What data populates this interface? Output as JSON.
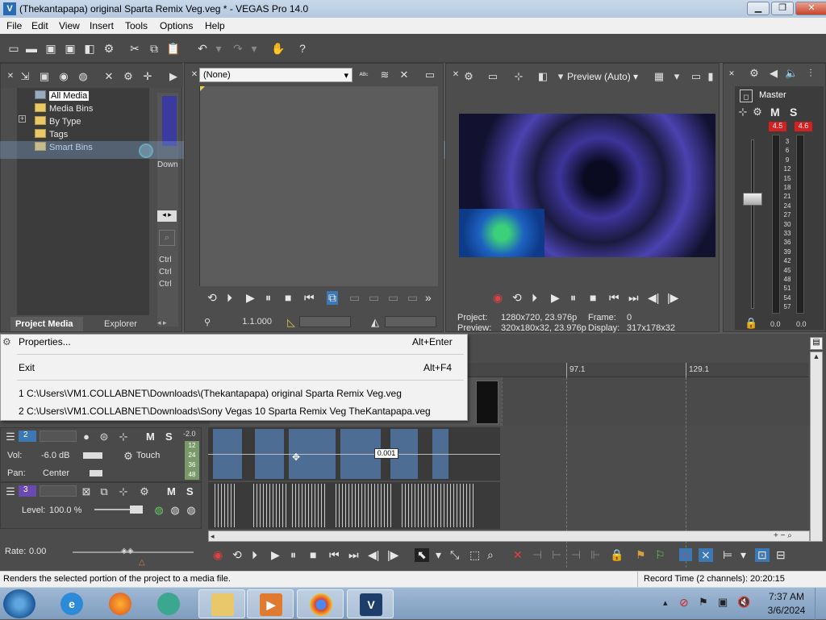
{
  "window": {
    "title": "(Thekantapapa) original Sparta Remix Veg.veg * - VEGAS Pro 14.0",
    "app_icon_letter": "V"
  },
  "menu": [
    "File",
    "Edit",
    "View",
    "Insert",
    "Tools",
    "Options",
    "Help"
  ],
  "project_media": {
    "tree": [
      "All Media",
      "Media Bins",
      "By Type",
      "Tags",
      "Smart Bins"
    ],
    "expander": "+",
    "tabs": [
      "Project Media",
      "Explorer"
    ],
    "side_label": "Down",
    "ctrl_labels": [
      "Ctrl",
      "Ctrl",
      "Ctrl"
    ]
  },
  "trimmer": {
    "dropdown_value": "(None)",
    "timecode": "1.1.000"
  },
  "preview": {
    "mode_label": "Preview (Auto)",
    "project_label": "Project:",
    "project_value": "1280x720, 23.976p",
    "preview_label": "Preview:",
    "preview_value": "320x180x32, 23.976p",
    "frame_label": "Frame:",
    "frame_value": "0",
    "display_label": "Display:",
    "display_value": "317x178x32"
  },
  "master": {
    "title": "Master",
    "mute_label": "M",
    "solo_label": "S",
    "peak_left": "4.5",
    "peak_right": "4.6",
    "scale": [
      "3",
      "6",
      "9",
      "12",
      "15",
      "18",
      "21",
      "24",
      "27",
      "30",
      "33",
      "36",
      "39",
      "42",
      "45",
      "48",
      "51",
      "54",
      "57"
    ],
    "bottom_left": "0.0",
    "bottom_right": "0.0"
  },
  "context_menu": {
    "items": [
      {
        "label": "Properties...",
        "shortcut": "Alt+Enter"
      },
      {
        "label": "Exit",
        "shortcut": "Alt+F4"
      },
      {
        "label": "1 C:\\Users\\VM1.COLLABNET\\Downloads\\(Thekantapapa) original Sparta Remix Veg.veg",
        "shortcut": ""
      },
      {
        "label": "2 C:\\Users\\VM1.COLLABNET\\Downloads\\Sony Vegas 10 Sparta Remix Veg TheKantapapa.veg",
        "shortcut": ""
      }
    ]
  },
  "timeline": {
    "ruler_marks": [
      "97.1",
      "129.1"
    ],
    "clip_tooltip": "0.001",
    "tracks": [
      {
        "number": "2",
        "vol_label": "Vol:",
        "vol_value": "-6.0 dB",
        "pan_label": "Pan:",
        "pan_value": "Center",
        "automation": "Touch",
        "meter_top": "-2.0",
        "meter_scale": [
          "12",
          "24",
          "36",
          "48"
        ],
        "mute": "M",
        "solo": "S"
      },
      {
        "number": "3",
        "level_label": "Level:",
        "level_value": "100.0 %",
        "mute": "M",
        "solo": "S"
      }
    ],
    "rate_label": "Rate:",
    "rate_value": "0.00"
  },
  "status": {
    "left": "Renders the selected portion of the project to a media file.",
    "right": "Record Time (2 channels): 20:20:15"
  },
  "taskbar": {
    "time": "7:37 AM",
    "date": "3/6/2024"
  },
  "colors": {
    "accent": "#3c8fd0",
    "meter_peak": "#d42020",
    "clip_blue": "#4e6d94"
  }
}
